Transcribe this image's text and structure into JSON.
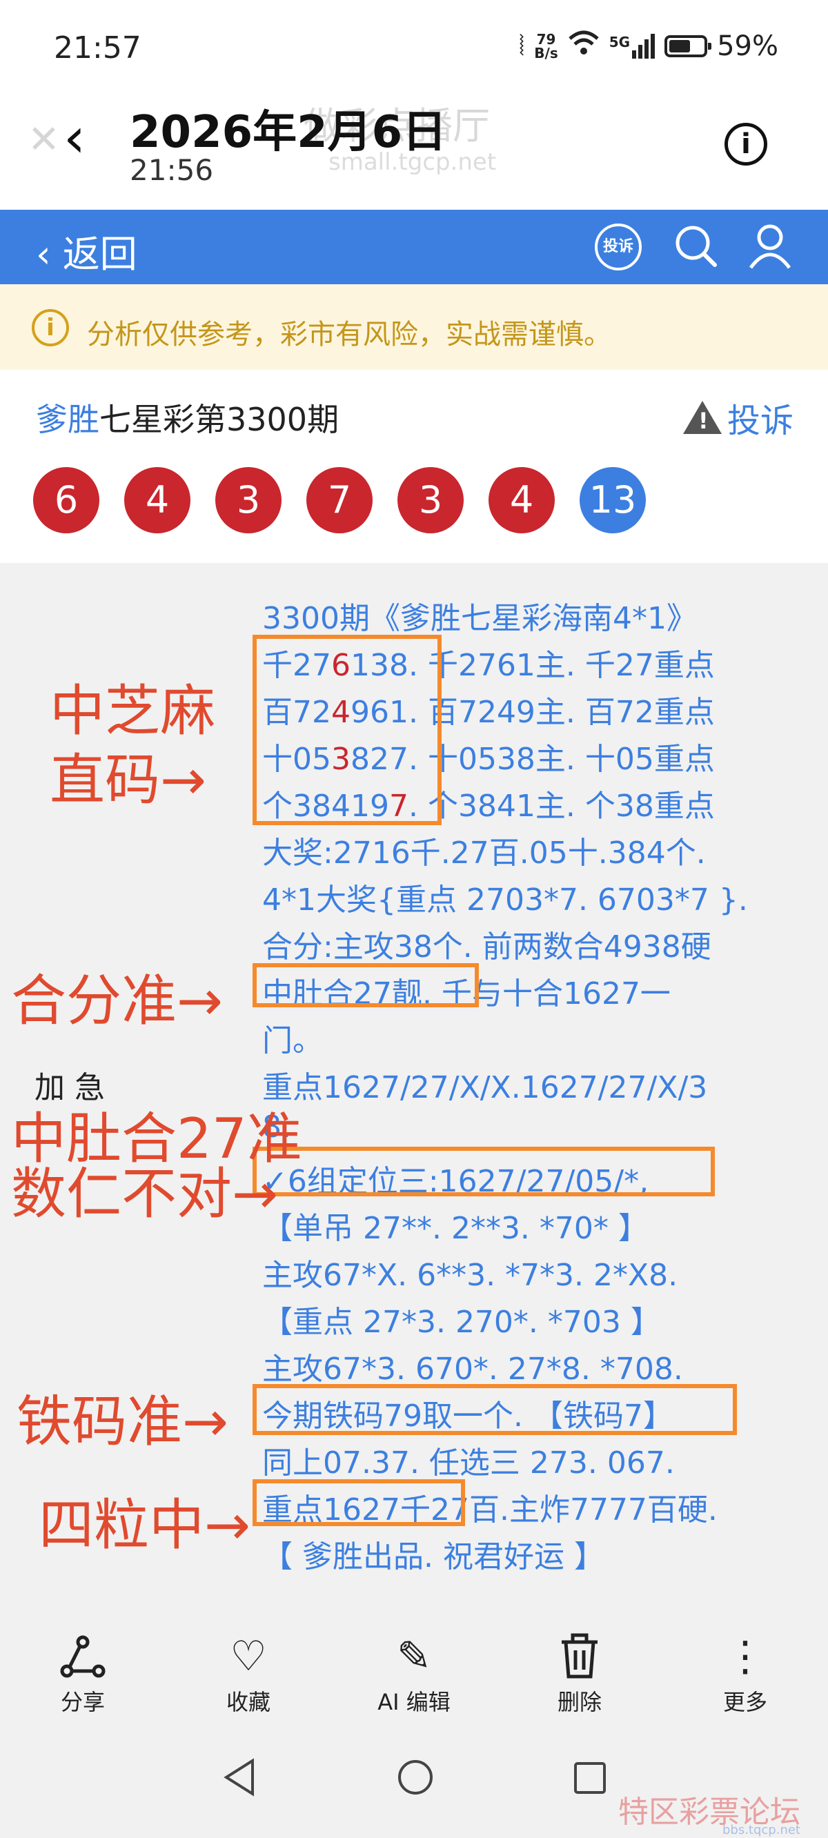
{
  "status_bar": {
    "time": "21:57",
    "net_speed_top": "79",
    "net_speed_bottom": "B/s",
    "network": "5G",
    "battery": "59%"
  },
  "header": {
    "title": "2026年2月6日",
    "subtitle": "21:56",
    "ghost_title": "做彩点播厅",
    "ghost_url": "small.tgcp.net"
  },
  "nav": {
    "back_label": "返回",
    "complain_icon_text": "投诉"
  },
  "notice": {
    "text": "分析仅供参考，彩市有风险，实战需谨慎。"
  },
  "post": {
    "brand": "爹胜",
    "title_rest": "七星彩第3300期",
    "report_label": "投诉",
    "balls": [
      "6",
      "4",
      "3",
      "7",
      "3",
      "4",
      "13"
    ]
  },
  "content": {
    "lines": [
      "3300期《爹胜七星彩海南4*1》",
      "千276138. 千2761主. 千27重点",
      "百724961. 百7249主. 百72重点",
      "十053827. 十0538主. 十05重点",
      "个384197. 个3841主. 个38重点",
      "大奖:2716千.27百.05十.384个.",
      "4*1大奖{重点 2703*7. 6703*7 }.",
      "合分:主攻38个. 前两数合4938硬",
      "中肚合27靓. 千与十合1627一",
      "门。",
      "重点1627/27/X/X.1627/27/X/3",
      "8.",
      "✓6组定位三:1627/27/05/*,",
      "【单吊 27**. 2**3. *70* 】",
      "主攻67*X. 6**3. *7*3. 2*X8.",
      "【重点 27*3. 270*. *703 】",
      "主攻67*3. 670*. 27*8. *708.",
      "今期铁码79取一个. 【铁码7】",
      "同上07.37. 任选三 273. 067.",
      "重点1627千27百.主炸7777百硬.",
      "【 爹胜出品. 祝君好运 】"
    ],
    "plain_note": "加 急"
  },
  "annotations": {
    "a1_line1": "中芝麻",
    "a1_line2": "直码→",
    "a2": "合分准→",
    "a3_line1": "中肚合27准",
    "a3_line2": "数仁不对→",
    "a4": "铁码准→",
    "a5": "四粒中→"
  },
  "toolbar": {
    "share": "分享",
    "favorite": "收藏",
    "ai_edit": "AI 编辑",
    "delete": "删除",
    "more": "更多"
  },
  "watermark": {
    "text": "特区彩票论坛",
    "url": "bbs.tqcp.net"
  }
}
